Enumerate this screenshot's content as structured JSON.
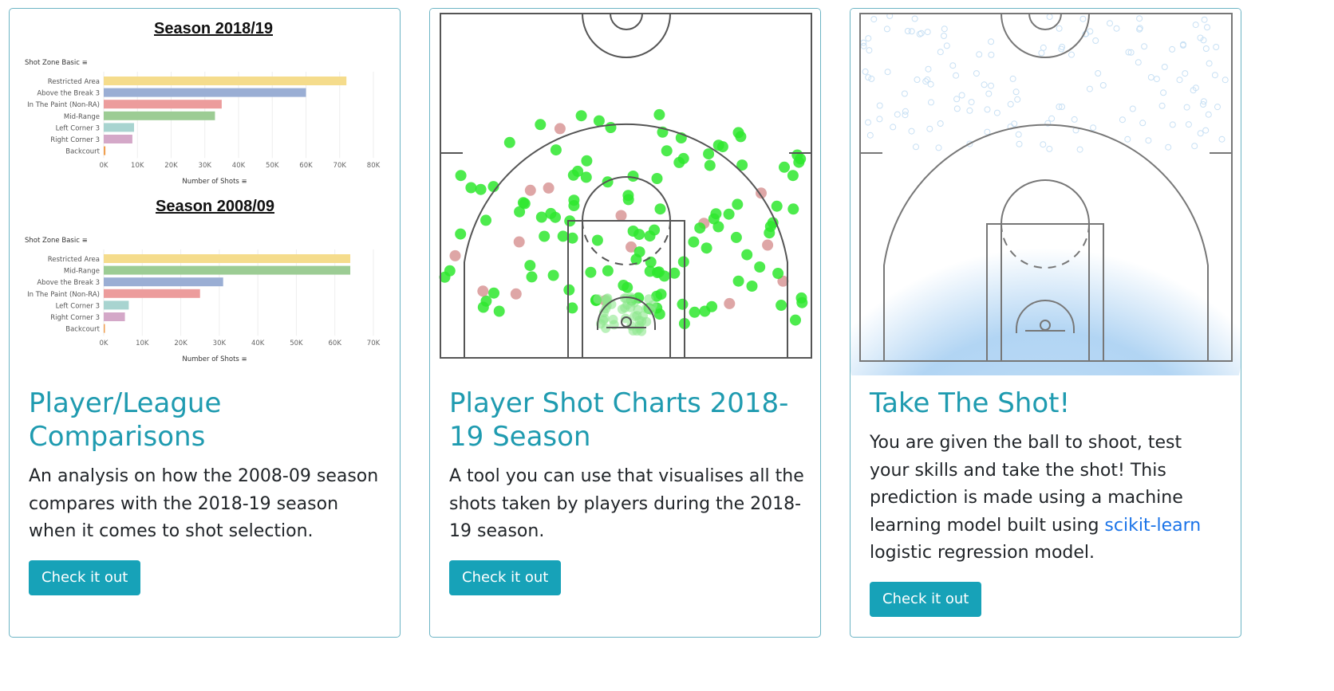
{
  "cards": [
    {
      "title": "Player/League Comparisons",
      "description": "An analysis on how the 2008-09 season compares with the 2018-19 season when it comes to shot selection.",
      "button": "Check it out"
    },
    {
      "title": "Player Shot Charts 2018-19 Season",
      "description": "A tool you can use that visualises all the shots taken by players during the 2018-19 season.",
      "button": "Check it out"
    },
    {
      "title": "Take The Shot!",
      "description_before": "You are given the ball to shoot, test your skills and take the shot! This prediction is made using a machine learning model built using ",
      "link": "scikit-learn",
      "description_after": " logistic regression model.",
      "button": "Check it out"
    }
  ],
  "chart_data": [
    {
      "type": "bar",
      "title": "Season 2018/19",
      "ylabel": "Shot Zone Basic",
      "xlabel": "Number of Shots",
      "categories": [
        "Restricted Area",
        "Above the Break 3",
        "In The Paint (Non-RA)",
        "Mid-Range",
        "Left Corner 3",
        "Right Corner 3",
        "Backcourt"
      ],
      "values": [
        72000,
        60000,
        35000,
        33000,
        9000,
        8500,
        500
      ],
      "colors": [
        "#f5dc8c",
        "#9aaed4",
        "#ec9c9c",
        "#9ccc94",
        "#a8d4d0",
        "#d4a8c8",
        "#f0a050"
      ],
      "xticks": [
        "0K",
        "10K",
        "20K",
        "30K",
        "40K",
        "50K",
        "60K",
        "70K",
        "80K"
      ],
      "xlim": [
        0,
        80000
      ]
    },
    {
      "type": "bar",
      "title": "Season 2008/09",
      "ylabel": "Shot Zone Basic",
      "xlabel": "Number of Shots",
      "categories": [
        "Restricted Area",
        "Mid-Range",
        "Above the Break 3",
        "In The Paint (Non-RA)",
        "Left Corner 3",
        "Right Corner 3",
        "Backcourt"
      ],
      "values": [
        64000,
        64000,
        31000,
        25000,
        6500,
        5500,
        300
      ],
      "colors": [
        "#f5dc8c",
        "#9ccc94",
        "#9aaed4",
        "#ec9c9c",
        "#a8d4d0",
        "#d4a8c8",
        "#f0a050"
      ],
      "xticks": [
        "0K",
        "10K",
        "20K",
        "30K",
        "40K",
        "50K",
        "60K",
        "70K"
      ],
      "xlim": [
        0,
        70000
      ]
    }
  ]
}
